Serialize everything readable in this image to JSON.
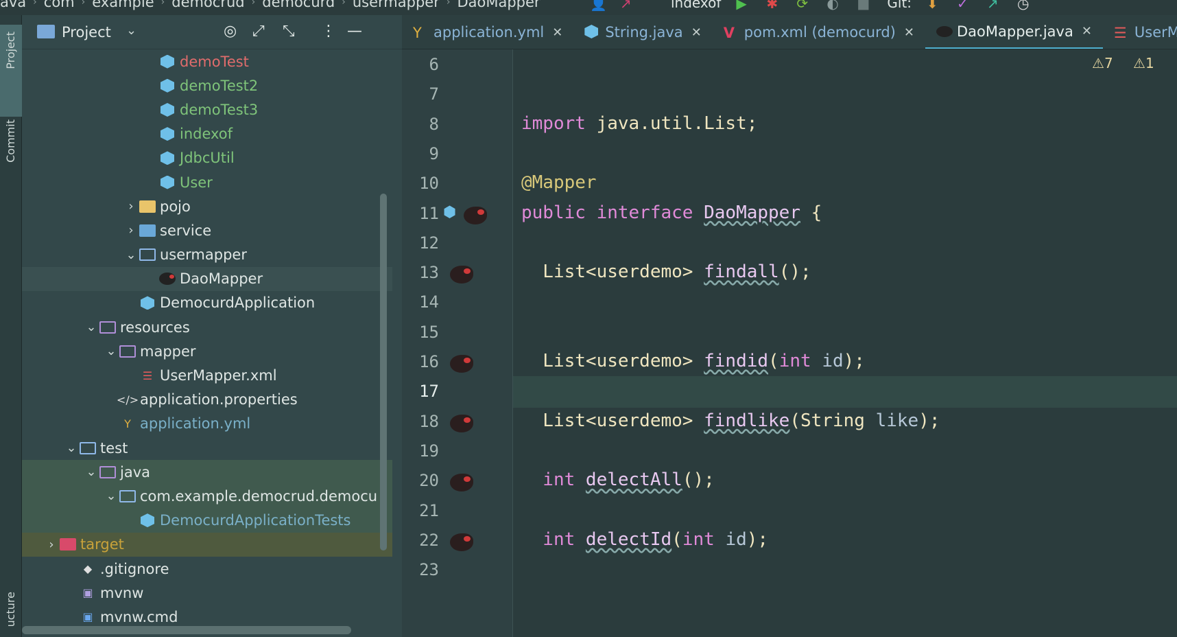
{
  "breadcrumb": {
    "items": [
      "ava",
      "com",
      "example",
      "democrud",
      "democurd",
      "usermapper",
      "DaoMapper"
    ]
  },
  "toolbar": {
    "run_config": "indexof",
    "git_label": "Git:"
  },
  "toolstrip": {
    "project": "Project",
    "commit": "Commit",
    "structure": "ucture"
  },
  "project_panel": {
    "title": "Project",
    "tree": [
      {
        "indent": 6,
        "arrow": "",
        "icon": "class",
        "label": "demoTest",
        "color": "red"
      },
      {
        "indent": 6,
        "arrow": "",
        "icon": "class",
        "label": "demoTest2",
        "color": "green"
      },
      {
        "indent": 6,
        "arrow": "",
        "icon": "class",
        "label": "demoTest3",
        "color": "green"
      },
      {
        "indent": 6,
        "arrow": "",
        "icon": "class",
        "label": "indexof",
        "color": "green"
      },
      {
        "indent": 6,
        "arrow": "",
        "icon": "class",
        "label": "JdbcUtil",
        "color": "green"
      },
      {
        "indent": 6,
        "arrow": "",
        "icon": "class",
        "label": "User",
        "color": "green"
      },
      {
        "indent": 5,
        "arrow": "›",
        "icon": "folder",
        "label": "pojo",
        "color": "norm"
      },
      {
        "indent": 5,
        "arrow": "›",
        "icon": "folder-svc",
        "label": "service",
        "color": "norm"
      },
      {
        "indent": 5,
        "arrow": "⌄",
        "icon": "folder-blue",
        "label": "usermapper",
        "color": "norm"
      },
      {
        "indent": 6,
        "arrow": "",
        "icon": "bird",
        "label": "DaoMapper",
        "color": "norm",
        "state": "sel"
      },
      {
        "indent": 5,
        "arrow": "",
        "icon": "class",
        "label": "DemocurdApplication",
        "color": "norm"
      },
      {
        "indent": 3,
        "arrow": "⌄",
        "icon": "folder-res",
        "label": "resources",
        "color": "norm"
      },
      {
        "indent": 4,
        "arrow": "⌄",
        "icon": "folder-res",
        "label": "mapper",
        "color": "norm"
      },
      {
        "indent": 5,
        "arrow": "",
        "icon": "xml",
        "label": "UserMapper.xml",
        "color": "norm"
      },
      {
        "indent": 4,
        "arrow": "",
        "icon": "props",
        "label": "application.properties",
        "color": "norm"
      },
      {
        "indent": 4,
        "arrow": "",
        "icon": "yml",
        "label": "application.yml",
        "color": "dim"
      },
      {
        "indent": 2,
        "arrow": "⌄",
        "icon": "folder-blue",
        "label": "test",
        "color": "norm"
      },
      {
        "indent": 3,
        "arrow": "⌄",
        "icon": "folder-res",
        "label": "java",
        "color": "norm",
        "state": "hl"
      },
      {
        "indent": 4,
        "arrow": "⌄",
        "icon": "folder-blue",
        "label": "com.example.democrud.democu",
        "color": "norm",
        "state": "hl"
      },
      {
        "indent": 5,
        "arrow": "",
        "icon": "class",
        "label": "DemocurdApplicationTests",
        "color": "dim",
        "state": "hl"
      },
      {
        "indent": 1,
        "arrow": "›",
        "icon": "folder-red",
        "label": "target",
        "color": "yellow",
        "state": "target"
      },
      {
        "indent": 2,
        "arrow": "",
        "icon": "git",
        "label": ".gitignore",
        "color": "norm"
      },
      {
        "indent": 2,
        "arrow": "",
        "icon": "term",
        "label": "mvnw",
        "color": "norm"
      },
      {
        "indent": 2,
        "arrow": "",
        "icon": "cmd",
        "label": "mvnw.cmd",
        "color": "norm"
      }
    ]
  },
  "tabs": [
    {
      "label": "application.yml",
      "icon": "yml",
      "active": false
    },
    {
      "label": "String.java",
      "icon": "class",
      "active": false
    },
    {
      "label": "pom.xml (democurd)",
      "icon": "maven",
      "active": false
    },
    {
      "label": "DaoMapper.java",
      "icon": "bird",
      "active": true
    },
    {
      "label": "UserMappe",
      "icon": "xml",
      "active": false
    }
  ],
  "inspections": {
    "warnings": "7",
    "weak_warnings": "1"
  },
  "editor": {
    "lines": [
      {
        "n": "6",
        "code": []
      },
      {
        "n": "7",
        "code": []
      },
      {
        "n": "8",
        "code": [
          [
            "kw",
            "import "
          ],
          [
            "ty",
            "java.util.List;"
          ]
        ]
      },
      {
        "n": "9",
        "code": []
      },
      {
        "n": "10",
        "code": [
          [
            "ann",
            "@Mapper"
          ]
        ]
      },
      {
        "n": "11",
        "code": [
          [
            "kw",
            "public interface "
          ],
          [
            "fn",
            "DaoMapper"
          ],
          [
            "ty",
            " {"
          ]
        ],
        "gutter": "both"
      },
      {
        "n": "12",
        "code": []
      },
      {
        "n": "13",
        "code": [
          [
            "ty",
            "  List<userdemo> "
          ],
          [
            "fn",
            "findall"
          ],
          [
            "ty",
            "();"
          ]
        ],
        "gutter": "bird"
      },
      {
        "n": "14",
        "code": []
      },
      {
        "n": "15",
        "code": []
      },
      {
        "n": "16",
        "code": [
          [
            "ty",
            "  List<userdemo> "
          ],
          [
            "fn",
            "findid"
          ],
          [
            "ty",
            "("
          ],
          [
            "kw",
            "int "
          ],
          [
            "param",
            "id"
          ],
          [
            "ty",
            ");"
          ]
        ],
        "gutter": "bird"
      },
      {
        "n": "17",
        "code": [],
        "current": true
      },
      {
        "n": "18",
        "code": [
          [
            "ty",
            "  List<userdemo> "
          ],
          [
            "fn",
            "findlike"
          ],
          [
            "ty",
            "(String "
          ],
          [
            "param",
            "like"
          ],
          [
            "ty",
            ");"
          ]
        ],
        "gutter": "bird"
      },
      {
        "n": "19",
        "code": []
      },
      {
        "n": "20",
        "code": [
          [
            "kw",
            "  int "
          ],
          [
            "fn",
            "delectAll"
          ],
          [
            "ty",
            "();"
          ]
        ],
        "gutter": "bird"
      },
      {
        "n": "21",
        "code": []
      },
      {
        "n": "22",
        "code": [
          [
            "kw",
            "  int "
          ],
          [
            "fn",
            "delectId"
          ],
          [
            "ty",
            "("
          ],
          [
            "kw",
            "int "
          ],
          [
            "param",
            "id"
          ],
          [
            "ty",
            ");"
          ]
        ],
        "gutter": "bird"
      },
      {
        "n": "23",
        "code": []
      }
    ]
  }
}
